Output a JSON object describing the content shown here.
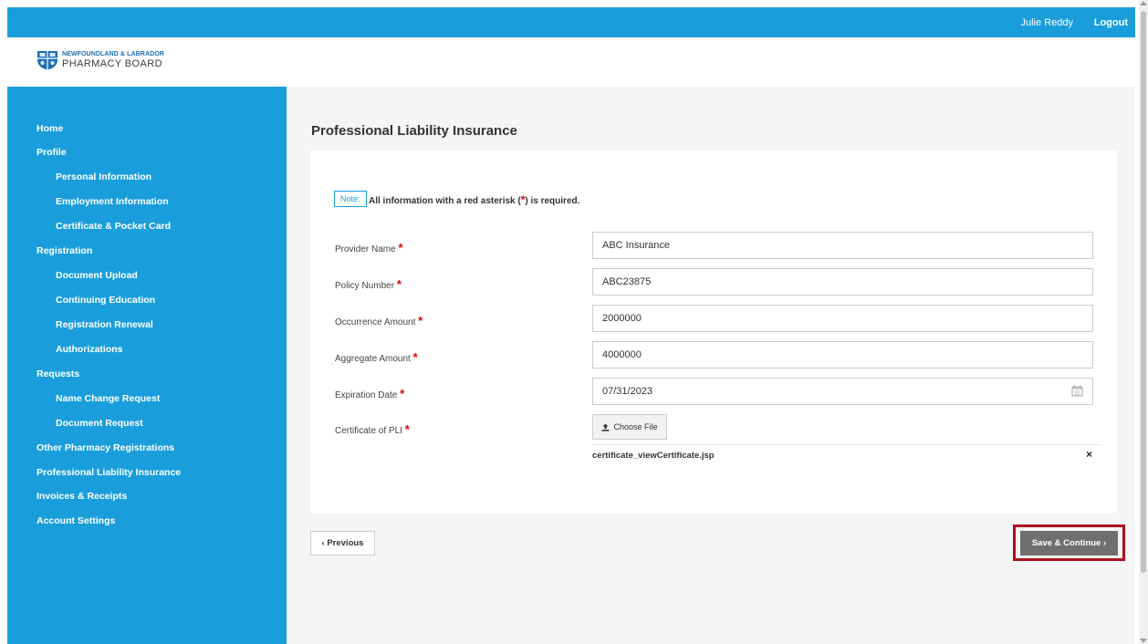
{
  "header": {
    "user_name": "Julie Reddy",
    "logout_label": "Logout",
    "brand_color": "#1a9edb"
  },
  "logo": {
    "line1": "NEWFOUNDLAND & LABRADOR",
    "line2": "PHARMACY BOARD"
  },
  "sidebar": {
    "items": [
      {
        "label": "Home",
        "level": 0
      },
      {
        "label": "Profile",
        "level": 0
      },
      {
        "label": "Personal Information",
        "level": 1
      },
      {
        "label": "Employment Information",
        "level": 1
      },
      {
        "label": "Certificate & Pocket Card",
        "level": 1
      },
      {
        "label": "Registration",
        "level": 0
      },
      {
        "label": "Document Upload",
        "level": 1
      },
      {
        "label": "Continuing Education",
        "level": 1
      },
      {
        "label": "Registration Renewal",
        "level": 1
      },
      {
        "label": "Authorizations",
        "level": 1
      },
      {
        "label": "Requests",
        "level": 0
      },
      {
        "label": "Name Change Request",
        "level": 1
      },
      {
        "label": "Document Request",
        "level": 1
      },
      {
        "label": "Other Pharmacy Registrations",
        "level": 0
      },
      {
        "label": "Professional Liability Insurance",
        "level": 0
      },
      {
        "label": "Invoices & Receipts",
        "level": 0
      },
      {
        "label": "Account Settings",
        "level": 0
      }
    ]
  },
  "main": {
    "title": "Professional Liability Insurance",
    "note_label": "Note:",
    "note_text_before": "All information with a red asterisk (",
    "note_asterisk": "*",
    "note_text_after": ") is required.",
    "fields": {
      "provider": {
        "label": "Provider Name",
        "value": "ABC Insurance"
      },
      "policy": {
        "label": "Policy Number",
        "value": "ABC23875"
      },
      "occurrence": {
        "label": "Occurrence Amount",
        "value": "2000000"
      },
      "aggregate": {
        "label": "Aggregate Amount",
        "value": "4000000"
      },
      "expiration": {
        "label": "Expiration Date",
        "value": "07/31/2023"
      },
      "certificate": {
        "label": "Certificate of PLI"
      }
    },
    "required_mark": "*",
    "choose_file_label": "Choose File",
    "file_name": "certificate_viewCertificate.jsp",
    "remove_icon": "×",
    "prev_label": "‹ Previous",
    "save_label": "Save & Continue ›",
    "highlight_color": "#b00f1f"
  }
}
